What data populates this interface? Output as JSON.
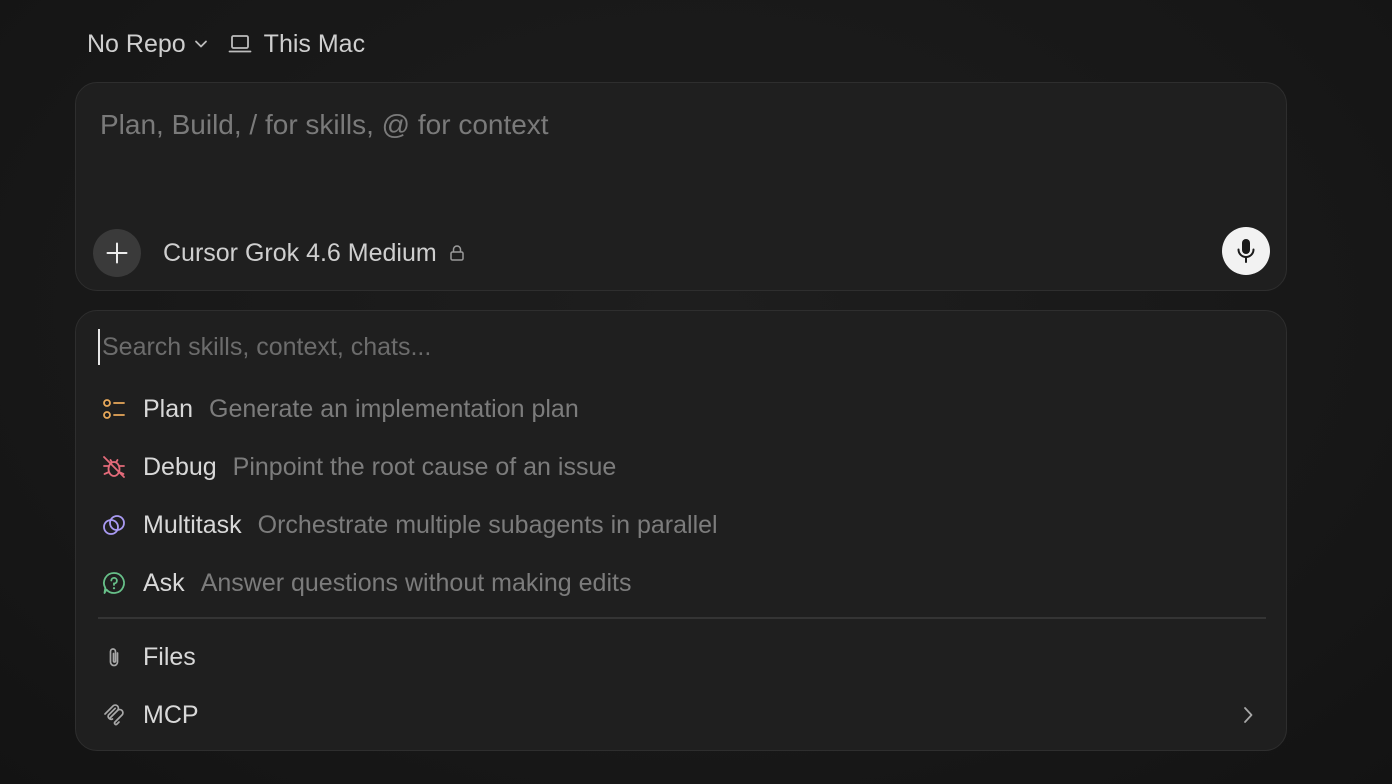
{
  "topbar": {
    "repo_label": "No Repo",
    "machine_label": "This Mac"
  },
  "composer": {
    "placeholder": "Plan, Build, / for skills, @ for context",
    "model_label": "Cursor Grok 4.6 Medium"
  },
  "menu": {
    "search_placeholder": "Search skills, context, chats...",
    "skills": [
      {
        "label": "Plan",
        "description": "Generate an implementation plan",
        "icon": "list-icon",
        "color": "#e7a85a"
      },
      {
        "label": "Debug",
        "description": "Pinpoint the root cause of an issue",
        "icon": "bug-off-icon",
        "color": "#e46b7a"
      },
      {
        "label": "Multitask",
        "description": "Orchestrate multiple subagents in parallel",
        "icon": "orbits-icon",
        "color": "#a99af2"
      },
      {
        "label": "Ask",
        "description": "Answer questions without making edits",
        "icon": "question-bubble-icon",
        "color": "#67c089"
      }
    ],
    "context": [
      {
        "label": "Files",
        "icon": "paperclip-icon"
      },
      {
        "label": "MCP",
        "icon": "mcp-icon"
      }
    ]
  },
  "colors": {
    "background": "#181818",
    "panel": "#1f1f1f",
    "border": "#2e2e2e",
    "muted_text": "#7c7c7c"
  }
}
